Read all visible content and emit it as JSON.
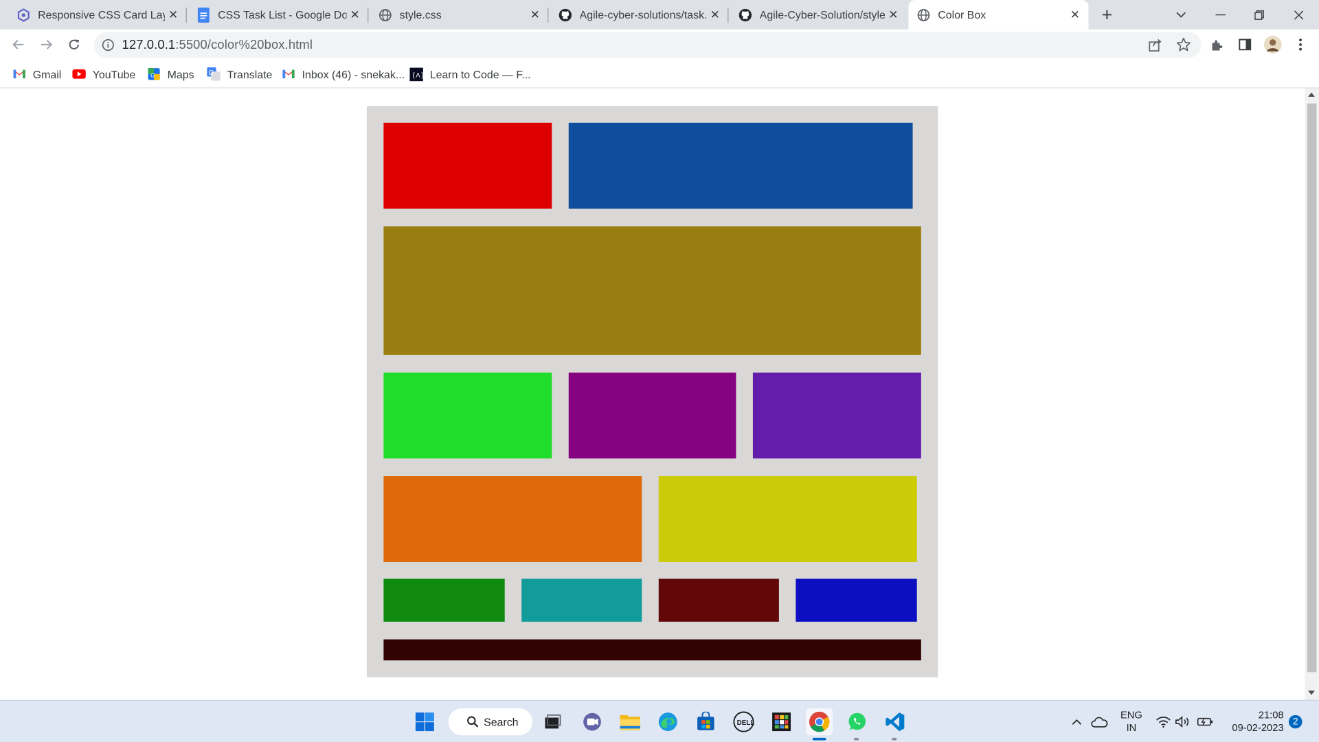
{
  "browser": {
    "tabs": [
      {
        "title": "Responsive CSS Card Layou",
        "icon": "card-layout-icon",
        "active": false
      },
      {
        "title": "CSS Task List - Google Docs",
        "icon": "google-docs-icon",
        "active": false
      },
      {
        "title": "style.css",
        "icon": "globe-icon",
        "active": false
      },
      {
        "title": "Agile-cyber-solutions/task.h",
        "icon": "github-icon",
        "active": false
      },
      {
        "title": "Agile-Cyber-Solution/styles",
        "icon": "github-icon",
        "active": false
      },
      {
        "title": "Color Box",
        "icon": "globe-icon",
        "active": true
      }
    ],
    "address": {
      "host": "127.0.0.1",
      "path": ":5500/color%20box.html"
    },
    "bookmarks": [
      {
        "label": "Gmail",
        "icon": "gmail-icon"
      },
      {
        "label": "YouTube",
        "icon": "youtube-icon"
      },
      {
        "label": "Maps",
        "icon": "maps-icon"
      },
      {
        "label": "Translate",
        "icon": "translate-icon"
      },
      {
        "label": "Inbox (46) - snekak...",
        "icon": "gmail-icon"
      },
      {
        "label": "Learn to Code — F...",
        "icon": "freecodecamp-icon"
      }
    ]
  },
  "page": {
    "frame_color": "#dad8d6",
    "boxes": [
      {
        "name": "red-box",
        "color": "#dd0000"
      },
      {
        "name": "blue-box",
        "color": "#0f4d9e"
      },
      {
        "name": "olive-box",
        "color": "#9a7d10"
      },
      {
        "name": "green-box",
        "color": "#1fdd2a"
      },
      {
        "name": "magenta-box",
        "color": "#870281"
      },
      {
        "name": "purple-box",
        "color": "#641dab"
      },
      {
        "name": "orange-box",
        "color": "#de6a0b"
      },
      {
        "name": "yellow-box",
        "color": "#cbcb08"
      },
      {
        "name": "dark-green-box",
        "color": "#108a10"
      },
      {
        "name": "teal-box",
        "color": "#129b9b"
      },
      {
        "name": "maroon-box",
        "color": "#620808"
      },
      {
        "name": "dark-blue-box",
        "color": "#0b0fc0"
      },
      {
        "name": "black-bar",
        "color": "#310303"
      }
    ]
  },
  "taskbar": {
    "search_label": "Search",
    "language": "ENG",
    "region": "IN",
    "time": "21:08",
    "date": "09-02-2023",
    "notification_count": "2",
    "apps": [
      "windows-start-icon",
      "task-view-icon",
      "teams-chat-icon",
      "file-explorer-icon",
      "edge-icon",
      "microsoft-store-icon",
      "dell-icon",
      "app-grid-icon",
      "chrome-icon",
      "whatsapp-icon",
      "vscode-icon"
    ]
  }
}
